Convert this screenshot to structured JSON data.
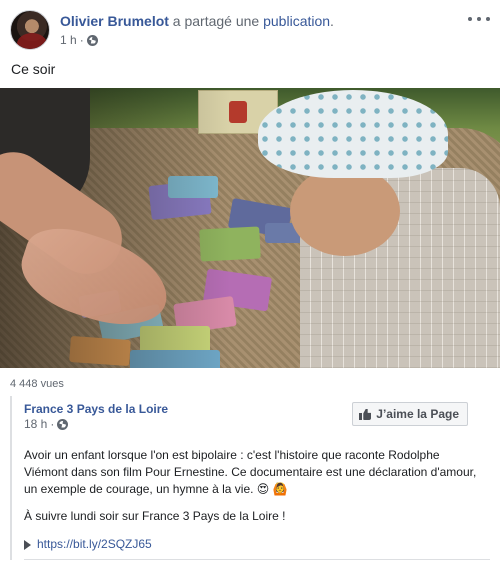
{
  "post": {
    "author": "Olivier Brumelot",
    "action_text": " a partagé une ",
    "action_link": "publication",
    "action_suffix": ".",
    "time": "1 h",
    "separator": "·",
    "status": "Ce soir"
  },
  "video": {
    "views": "4 448 vues"
  },
  "shared_page": {
    "name": "France 3 Pays de la Loire",
    "time": "18 h",
    "separator": "·",
    "like_button": "J’aime la Page",
    "text": "Avoir un enfant lorsque l'on est bipolaire : c'est l'histoire que raconte Rodolphe Viémont dans son film Pour Ernestine. Ce documentaire est une déclaration d'amour, un exemple de courage, un hymne à la vie. 😍 🙆",
    "text2": "À suivre lundi soir sur France 3 Pays de la Loire !",
    "link": "https://bit.ly/2SQZJ65"
  },
  "icons": {
    "globe": "globe-icon",
    "more": "more-options-icon",
    "thumb": "thumbs-up-icon",
    "play": "play-icon"
  },
  "colors": {
    "link": "#385898",
    "meta": "#606770",
    "text": "#1c1e21"
  }
}
